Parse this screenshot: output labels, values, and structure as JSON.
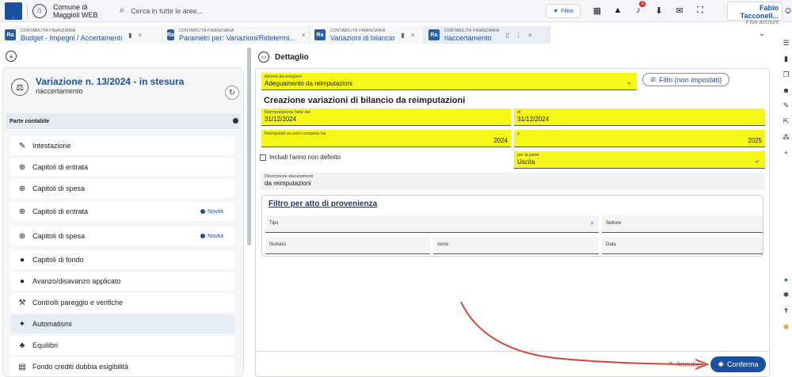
{
  "topbar": {
    "app_name": "Comune di Maggioli WEB",
    "search_placeholder": "Cerca in tutte le aree...",
    "filter_label": "Filtra",
    "notification_count": "3",
    "user_name": "Fabio Tacconell...",
    "user_role": "Il tuo account"
  },
  "tabs": [
    {
      "category": "CONTABILITÀ FINANZIARIA",
      "title": "Budget - Impegni / Accertamenti"
    },
    {
      "category": "CONTABILITÀ FINANZIARIA",
      "title": "Parametri per: Variazioni/Ridetermi..."
    },
    {
      "category": "CONTABILITÀ FINANZIARIA",
      "title": "Variazioni di bilancio"
    },
    {
      "category": "CONTABILITÀ FINANZIARIA",
      "title": "riaccertamento"
    }
  ],
  "left": {
    "title": "Variazione n. 13/2024 - in stesura",
    "subtitle": "riaccertamento",
    "section": "Parte contabile",
    "items": [
      {
        "label": "Intestazione",
        "icon": "pencil-icon"
      },
      {
        "label": "Capitoli di entrata",
        "icon": "arrow-down-circle-icon"
      },
      {
        "label": "Capitoli di spesa",
        "icon": "arrow-up-circle-icon"
      },
      {
        "label": "Capitoli di entrata",
        "icon": "arrow-down-circle-icon",
        "badge": "Novità"
      },
      {
        "label": "Capitoli di spesa",
        "icon": "arrow-up-circle-icon",
        "badge": "Novità"
      },
      {
        "label": "Capitoli di fondo",
        "icon": "piggy-bank-icon"
      },
      {
        "label": "Avanzo/disavanzo applicato",
        "icon": "piggy-bank-icon"
      },
      {
        "label": "Controlli pareggio e verifiche",
        "icon": "wrench-icon"
      },
      {
        "label": "Automatismi",
        "icon": "magic-wand-icon"
      },
      {
        "label": "Equilibri",
        "icon": "sitemap-icon"
      },
      {
        "label": "Fondo crediti dubbia esigibilità",
        "icon": "list-icon"
      }
    ]
  },
  "detail": {
    "header": "Dettaglio",
    "azione_label": "Azione da eseguire",
    "azione_value": "Adeguamento da reimputazioni",
    "filtri_label": "Filtri (non impostati)",
    "heading": "Creazione variazioni di bilancio da reimputazioni",
    "reimp_label": "Reimputazione fatte dal",
    "reimp_value": "31/12/2024",
    "al_label": "al",
    "al_value": "31/12/2024",
    "anni_label": "Reimputati su anni compresi fra",
    "anni_value": "2024",
    "e_label": "e",
    "e_value": "2025",
    "includi_label": "Includi l'anno non definito",
    "parte_label": "per la parte",
    "parte_value": "Uscita",
    "descr_label": "Descrizione stanziamenti",
    "descr_value": "da reimputazioni",
    "filtro_title": "Filtro per atto di provenienza",
    "tipo_label": "Tipo",
    "settore_label": "Settore",
    "numero_label": "Numero",
    "anno_label": "Anno",
    "data_label": "Data",
    "annulla_label": "Annulla",
    "conferma_label": "Conferma"
  }
}
